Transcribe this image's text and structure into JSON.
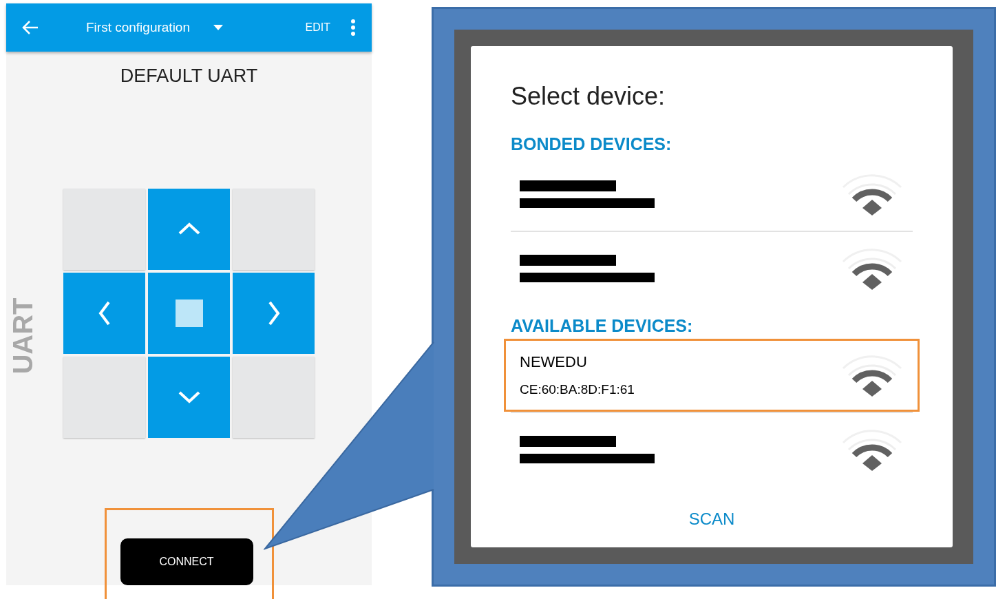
{
  "app_screen": {
    "toolbar": {
      "title": "First configuration",
      "action": "EDIT"
    },
    "heading": "DEFAULT UART",
    "side_label": "UART",
    "pad": [
      {
        "kind": "blank"
      },
      {
        "kind": "up"
      },
      {
        "kind": "blank"
      },
      {
        "kind": "left"
      },
      {
        "kind": "stop"
      },
      {
        "kind": "right"
      },
      {
        "kind": "blank"
      },
      {
        "kind": "down"
      },
      {
        "kind": "blank"
      }
    ],
    "connect_button": {
      "label": "CONNECT",
      "highlighted": true
    }
  },
  "dialog": {
    "title": "Select device:",
    "sections": [
      {
        "heading": "BONDED DEVICES:",
        "devices": [
          {
            "kind": "redacted",
            "highlighted": false
          },
          {
            "kind": "redacted",
            "highlighted": false
          }
        ]
      },
      {
        "heading": "AVAILABLE DEVICES:",
        "devices": [
          {
            "kind": "device",
            "name": "NEWEDU",
            "address": "CE:60:BA:8D:F1:61",
            "highlighted": true
          },
          {
            "kind": "redacted",
            "highlighted": false
          }
        ]
      }
    ],
    "scan_button": "SCAN"
  }
}
